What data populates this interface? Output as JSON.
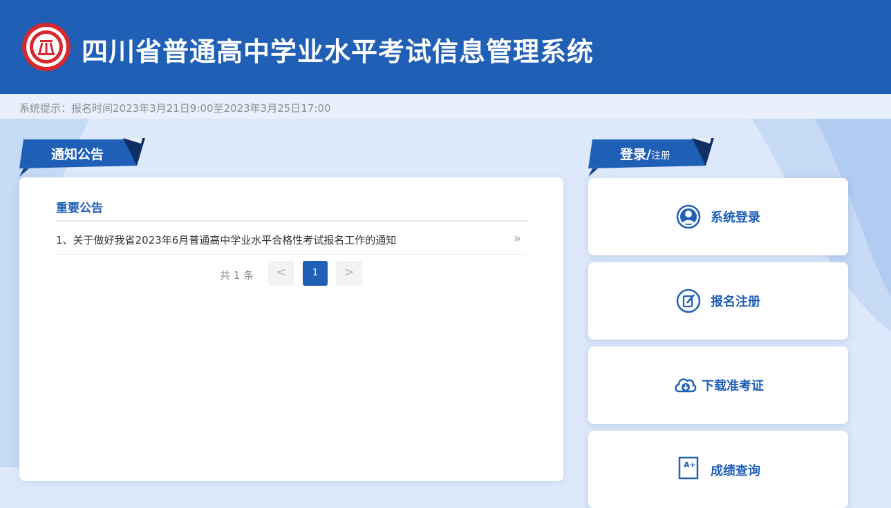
{
  "header": {
    "title": "四川省普通高中学业水平考试信息管理系统",
    "logo_icon": "emblem-logo-icon"
  },
  "notice_bar": {
    "text": "系统提示：报名时间2023年3月21日9:00至2023年3月25日17:00"
  },
  "announcements": {
    "tab_label": "通知公告",
    "heading": "重要公告",
    "items": [
      {
        "text": "1、关于做好我省2023年6月普通高中学业水平合格性考试报名工作的通知",
        "arrow": "»"
      }
    ],
    "pagination": {
      "total_label": "共 1 条",
      "prev_label": "<",
      "next_label": ">",
      "current_page": "1"
    }
  },
  "login_panel": {
    "tab_label_main": "登录/",
    "tab_label_sub": "注册",
    "actions": [
      {
        "label": "系统登录",
        "icon": "user-circle-icon"
      },
      {
        "label": "报名注册",
        "icon": "edit-register-icon"
      },
      {
        "label": "下载准考证",
        "icon": "cloud-download-icon"
      },
      {
        "label": "成绩查询",
        "icon": "grade-query-icon"
      }
    ]
  },
  "colors": {
    "primary": "#1f5fb5",
    "background": "#dde9fa",
    "notice_bar": "#e7f0fb",
    "panel": "#ffffff"
  }
}
